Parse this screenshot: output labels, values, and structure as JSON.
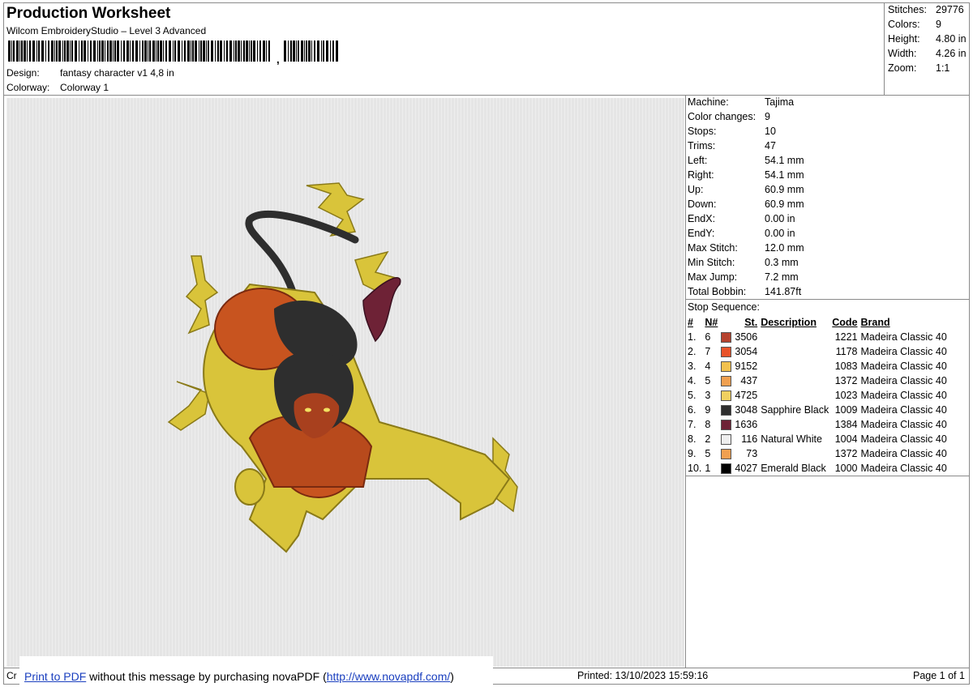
{
  "header": {
    "title": "Production Worksheet",
    "subtitle": "Wilcom EmbroideryStudio – Level 3 Advanced",
    "design_label": "Design:",
    "design_value": "fantasy character v1 4,8 in",
    "colorway_label": "Colorway:",
    "colorway_value": "Colorway 1"
  },
  "stats": [
    {
      "label": "Stitches:",
      "value": "29776"
    },
    {
      "label": "Colors:",
      "value": "9"
    },
    {
      "label": "Height:",
      "value": "4.80 in"
    },
    {
      "label": "Width:",
      "value": "4.26 in"
    },
    {
      "label": "Zoom:",
      "value": "1:1"
    }
  ],
  "machine_info": [
    {
      "label": "Machine:",
      "value": "Tajima"
    },
    {
      "label": "Color changes:",
      "value": "9"
    },
    {
      "label": "Stops:",
      "value": "10"
    },
    {
      "label": "Trims:",
      "value": "47"
    },
    {
      "label": "Left:",
      "value": "54.1 mm"
    },
    {
      "label": "Right:",
      "value": "54.1 mm"
    },
    {
      "label": "Up:",
      "value": "60.9 mm"
    },
    {
      "label": "Down:",
      "value": "60.9 mm"
    },
    {
      "label": "EndX:",
      "value": "0.00 in"
    },
    {
      "label": "EndY:",
      "value": "0.00 in"
    },
    {
      "label": "Max Stitch:",
      "value": "12.0 mm"
    },
    {
      "label": "Min Stitch:",
      "value": "0.3 mm"
    },
    {
      "label": "Max Jump:",
      "value": "7.2 mm"
    },
    {
      "label": "Total Bobbin:",
      "value": "141.87ft"
    }
  ],
  "stop_sequence": {
    "title": "Stop Sequence:",
    "headers": {
      "idx": "#",
      "n": "N#",
      "st": "St.",
      "desc": "Description",
      "code": "Code",
      "brand": "Brand"
    },
    "rows": [
      {
        "idx": "1.",
        "n": "6",
        "color": "#b5422e",
        "st": "3506",
        "desc": "",
        "code": "1221",
        "brand": "Madeira Classic 40"
      },
      {
        "idx": "2.",
        "n": "7",
        "color": "#e8532a",
        "st": "3054",
        "desc": "",
        "code": "1178",
        "brand": "Madeira Classic 40"
      },
      {
        "idx": "3.",
        "n": "4",
        "color": "#f2c14e",
        "st": "9152",
        "desc": "",
        "code": "1083",
        "brand": "Madeira Classic 40"
      },
      {
        "idx": "4.",
        "n": "5",
        "color": "#f0a050",
        "st": "437",
        "desc": "",
        "code": "1372",
        "brand": "Madeira Classic 40"
      },
      {
        "idx": "5.",
        "n": "3",
        "color": "#f0d060",
        "st": "4725",
        "desc": "",
        "code": "1023",
        "brand": "Madeira Classic 40"
      },
      {
        "idx": "6.",
        "n": "9",
        "color": "#2e2e2e",
        "st": "3048",
        "desc": "Sapphire Black",
        "code": "1009",
        "brand": "Madeira Classic 40"
      },
      {
        "idx": "7.",
        "n": "8",
        "color": "#6e2236",
        "st": "1636",
        "desc": "",
        "code": "1384",
        "brand": "Madeira Classic 40"
      },
      {
        "idx": "8.",
        "n": "2",
        "color": "#eeeeee",
        "st": "116",
        "desc": "Natural White",
        "code": "1004",
        "brand": "Madeira Classic 40"
      },
      {
        "idx": "9.",
        "n": "5",
        "color": "#f0a050",
        "st": "73",
        "desc": "",
        "code": "1372",
        "brand": "Madeira Classic 40"
      },
      {
        "idx": "10.",
        "n": "1",
        "color": "#000000",
        "st": "4027",
        "desc": "Emerald Black",
        "code": "1000",
        "brand": "Madeira Classic 40"
      }
    ]
  },
  "footer": {
    "cr": "Cr",
    "print_to_pdf": "Print to PDF",
    "nova_msg": " without this message by purchasing novaPDF (",
    "nova_url": "http://www.novapdf.com/",
    "nova_close": ")",
    "printed": "Printed: 13/10/2023 15:59:16",
    "page": "Page 1 of 1"
  },
  "colors": {
    "skin_yellow": "#d9c43a",
    "orange_suit": "#c8541f",
    "dark": "#2e2e2e",
    "maroon": "#6e2236",
    "preview_bg": "#e5e5e5",
    "link": "#1a3fbf"
  }
}
